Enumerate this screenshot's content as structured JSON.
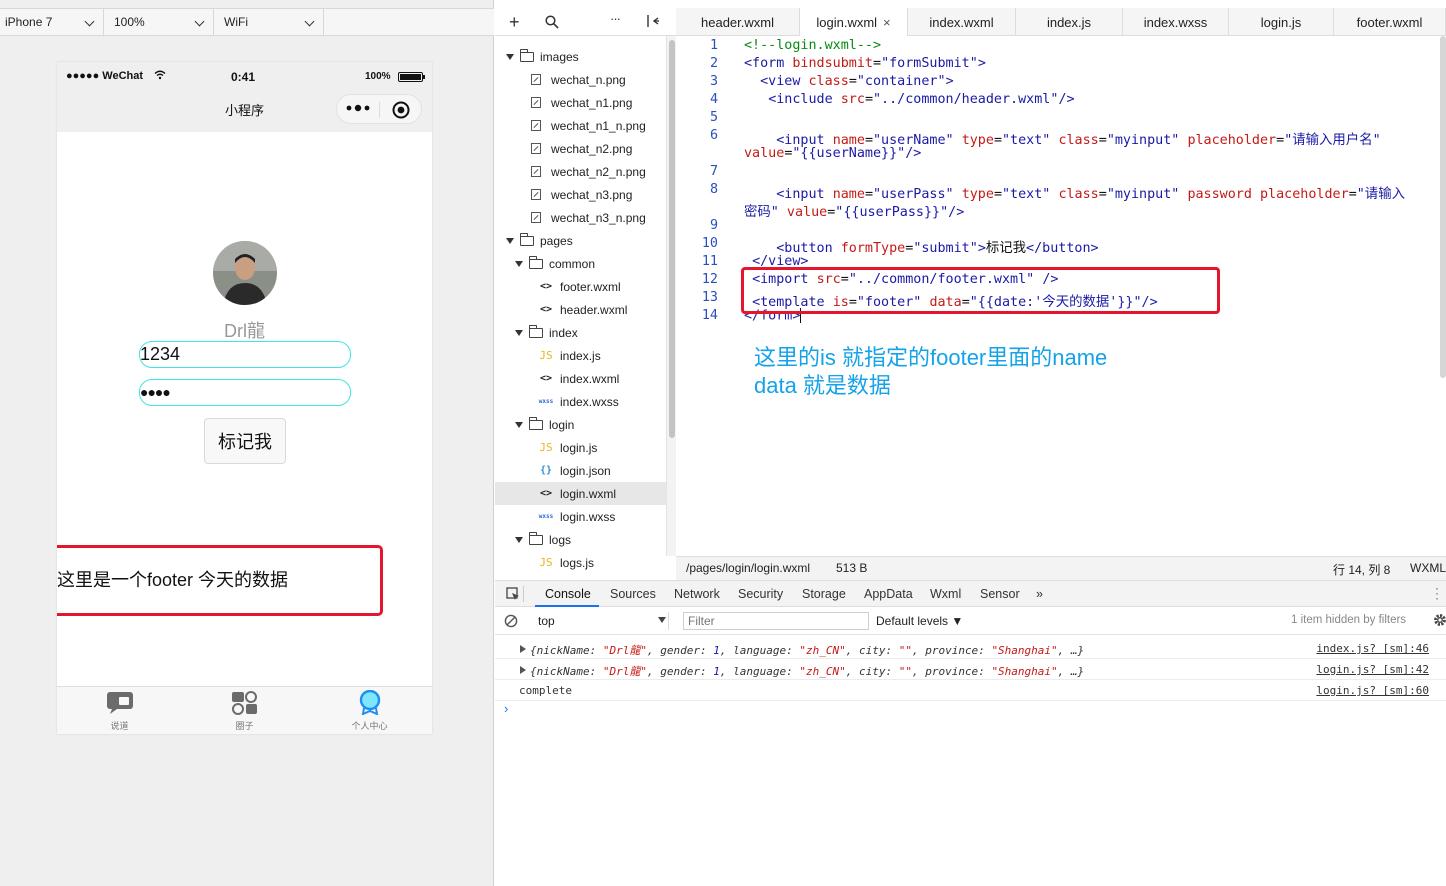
{
  "simulator": {
    "device": "iPhone 7",
    "zoom": "100%",
    "network": "WiFi",
    "status_bar": {
      "carrier": "●●●●● WeChat",
      "time": "0:41",
      "battery": "100%"
    },
    "nav_title": "小程序",
    "nickname": "Drl龍",
    "username_value": "1234",
    "password_value": "●●●●",
    "button_label": "标记我",
    "footer_text": "这里是一个footer 今天的数据",
    "tabbar": [
      {
        "label": "说道",
        "icon": "chat-bubble-icon"
      },
      {
        "label": "圈子",
        "icon": "circles-icon"
      },
      {
        "label": "个人中心",
        "icon": "profile-badge-icon"
      }
    ]
  },
  "file_tree": [
    {
      "depth": 0,
      "type": "folder",
      "name": "images"
    },
    {
      "depth": 1,
      "type": "image",
      "name": "wechat_n.png"
    },
    {
      "depth": 1,
      "type": "image",
      "name": "wechat_n1.png"
    },
    {
      "depth": 1,
      "type": "image",
      "name": "wechat_n1_n.png"
    },
    {
      "depth": 1,
      "type": "image",
      "name": "wechat_n2.png"
    },
    {
      "depth": 1,
      "type": "image",
      "name": "wechat_n2_n.png"
    },
    {
      "depth": 1,
      "type": "image",
      "name": "wechat_n3.png"
    },
    {
      "depth": 1,
      "type": "image",
      "name": "wechat_n3_n.png"
    },
    {
      "depth": 0,
      "type": "folder",
      "name": "pages"
    },
    {
      "depth": 1,
      "type": "folder",
      "name": "common"
    },
    {
      "depth": 2,
      "type": "wxml",
      "name": "footer.wxml"
    },
    {
      "depth": 2,
      "type": "wxml",
      "name": "header.wxml"
    },
    {
      "depth": 1,
      "type": "folder",
      "name": "index"
    },
    {
      "depth": 2,
      "type": "js",
      "name": "index.js"
    },
    {
      "depth": 2,
      "type": "wxml",
      "name": "index.wxml"
    },
    {
      "depth": 2,
      "type": "wxss",
      "name": "index.wxss"
    },
    {
      "depth": 1,
      "type": "folder",
      "name": "login"
    },
    {
      "depth": 2,
      "type": "js",
      "name": "login.js"
    },
    {
      "depth": 2,
      "type": "json",
      "name": "login.json"
    },
    {
      "depth": 2,
      "type": "wxml",
      "name": "login.wxml",
      "selected": true
    },
    {
      "depth": 2,
      "type": "wxss",
      "name": "login.wxss"
    },
    {
      "depth": 1,
      "type": "folder",
      "name": "logs"
    },
    {
      "depth": 2,
      "type": "js",
      "name": "logs.js"
    }
  ],
  "file_icons": {
    "wxml": "<>",
    "js": "JS",
    "json": "{}",
    "wxss": "wxss"
  },
  "editor_tabs": [
    "header.wxml",
    "login.wxml",
    "index.wxml",
    "index.js",
    "index.wxss",
    "login.js",
    "footer.wxml"
  ],
  "active_tab": "login.wxml",
  "code_lines": [
    {
      "n": "1",
      "tokens": [
        [
          "com",
          "<!--login.wxml-->"
        ]
      ]
    },
    {
      "n": "2",
      "tokens": [
        [
          "tag",
          "<form "
        ],
        [
          "attr",
          "bindsubmit"
        ],
        [
          "txt",
          "="
        ],
        [
          "str",
          "\"formSubmit\""
        ],
        [
          "tag",
          ">"
        ]
      ]
    },
    {
      "n": "3",
      "tokens": [
        [
          "txt",
          "  "
        ],
        [
          "tag",
          "<view "
        ],
        [
          "attr",
          "class"
        ],
        [
          "txt",
          "="
        ],
        [
          "str",
          "\"container\""
        ],
        [
          "tag",
          ">"
        ]
      ]
    },
    {
      "n": "4",
      "tokens": [
        [
          "txt",
          "   "
        ],
        [
          "tag",
          "<include "
        ],
        [
          "attr",
          "src"
        ],
        [
          "txt",
          "="
        ],
        [
          "str",
          "\"../common/header.wxml\""
        ],
        [
          "tag",
          "/>"
        ]
      ]
    },
    {
      "n": "5",
      "tokens": []
    },
    {
      "n": "6",
      "tokens": [
        [
          "txt",
          "    "
        ],
        [
          "tag",
          "<input "
        ],
        [
          "attr",
          "name"
        ],
        [
          "txt",
          "="
        ],
        [
          "str",
          "\"userName\""
        ],
        [
          "txt",
          " "
        ],
        [
          "attr",
          "type"
        ],
        [
          "txt",
          "="
        ],
        [
          "str",
          "\"text\""
        ],
        [
          "txt",
          " "
        ],
        [
          "attr",
          "class"
        ],
        [
          "txt",
          "="
        ],
        [
          "str",
          "\"myinput\""
        ],
        [
          "txt",
          " "
        ],
        [
          "attr",
          "placeholder"
        ],
        [
          "txt",
          "="
        ],
        [
          "str",
          "\"请输入用户名\""
        ]
      ]
    },
    {
      "n": "",
      "tokens": [
        [
          "attr",
          "value"
        ],
        [
          "txt",
          "="
        ],
        [
          "str",
          "\"{{userName}}\""
        ],
        [
          "tag",
          "/>"
        ]
      ]
    },
    {
      "n": "7",
      "tokens": []
    },
    {
      "n": "8",
      "tokens": [
        [
          "txt",
          "    "
        ],
        [
          "tag",
          "<input "
        ],
        [
          "attr",
          "name"
        ],
        [
          "txt",
          "="
        ],
        [
          "str",
          "\"userPass\""
        ],
        [
          "txt",
          " "
        ],
        [
          "attr",
          "type"
        ],
        [
          "txt",
          "="
        ],
        [
          "str",
          "\"text\""
        ],
        [
          "txt",
          " "
        ],
        [
          "attr",
          "class"
        ],
        [
          "txt",
          "="
        ],
        [
          "str",
          "\"myinput\""
        ],
        [
          "txt",
          " "
        ],
        [
          "attr",
          "password"
        ],
        [
          "txt",
          " "
        ],
        [
          "attr",
          "placeholder"
        ],
        [
          "txt",
          "="
        ],
        [
          "str",
          "\"请输入"
        ]
      ]
    },
    {
      "n": "",
      "tokens": [
        [
          "str",
          "密码\""
        ],
        [
          "txt",
          " "
        ],
        [
          "attr",
          "value"
        ],
        [
          "txt",
          "="
        ],
        [
          "str",
          "\"{{userPass}}\""
        ],
        [
          "tag",
          "/>"
        ]
      ]
    },
    {
      "n": "9",
      "tokens": []
    },
    {
      "n": "10",
      "tokens": [
        [
          "txt",
          "    "
        ],
        [
          "tag",
          "<button "
        ],
        [
          "attr",
          "formType"
        ],
        [
          "txt",
          "="
        ],
        [
          "str",
          "\"submit\""
        ],
        [
          "tag",
          ">"
        ],
        [
          "txt",
          "标记我"
        ],
        [
          "tag",
          "</button>"
        ]
      ]
    },
    {
      "n": "11",
      "tokens": [
        [
          "txt",
          " "
        ],
        [
          "tag",
          "</view>"
        ]
      ]
    },
    {
      "n": "12",
      "tokens": [
        [
          "txt",
          " "
        ],
        [
          "tag",
          "<import "
        ],
        [
          "attr",
          "src"
        ],
        [
          "txt",
          "="
        ],
        [
          "str",
          "\"../common/footer.wxml\""
        ],
        [
          "txt",
          " "
        ],
        [
          "tag",
          "/>"
        ]
      ]
    },
    {
      "n": "13",
      "tokens": [
        [
          "txt",
          " "
        ],
        [
          "tag",
          "<template "
        ],
        [
          "attr",
          "is"
        ],
        [
          "txt",
          "="
        ],
        [
          "str",
          "\"footer\""
        ],
        [
          "txt",
          " "
        ],
        [
          "attr",
          "data"
        ],
        [
          "txt",
          "="
        ],
        [
          "str",
          "\"{{date:'今天的数据'}}\""
        ],
        [
          "tag",
          "/>"
        ]
      ]
    },
    {
      "n": "14",
      "tokens": [
        [
          "tag",
          "</form>"
        ]
      ]
    }
  ],
  "annotation": [
    "这里的is 就指定的footer里面的name",
    "data 就是数据"
  ],
  "editor_status": {
    "path": "/pages/login/login.wxml",
    "size": "513 B",
    "cursor": "行 14, 列 8",
    "lang": "WXML"
  },
  "devtools": {
    "tabs": [
      "Console",
      "Sources",
      "Network",
      "Security",
      "Storage",
      "AppData",
      "Wxml",
      "Sensor",
      "»"
    ],
    "active_tab": "Console",
    "context": "top",
    "filter_placeholder": "Filter",
    "levels": "Default levels ▼",
    "hidden_note": "1 item hidden by filters",
    "logs": [
      {
        "expandable": true,
        "source": "index.js? [sm]:46"
      },
      {
        "expandable": true,
        "source": "login.js? [sm]:42"
      },
      {
        "expandable": false,
        "text": "complete",
        "source": "login.js? [sm]:60"
      }
    ],
    "log_object": {
      "nick_key": "nickName",
      "nick_val": "\"Drl龍\"",
      "gender_key": "gender",
      "gender_val": "1",
      "lang_key": "language",
      "lang_val": "\"zh_CN\"",
      "city_key": "city",
      "city_val": "\"\"",
      "prov_key": "province",
      "prov_val": "\"Shanghai\""
    }
  }
}
